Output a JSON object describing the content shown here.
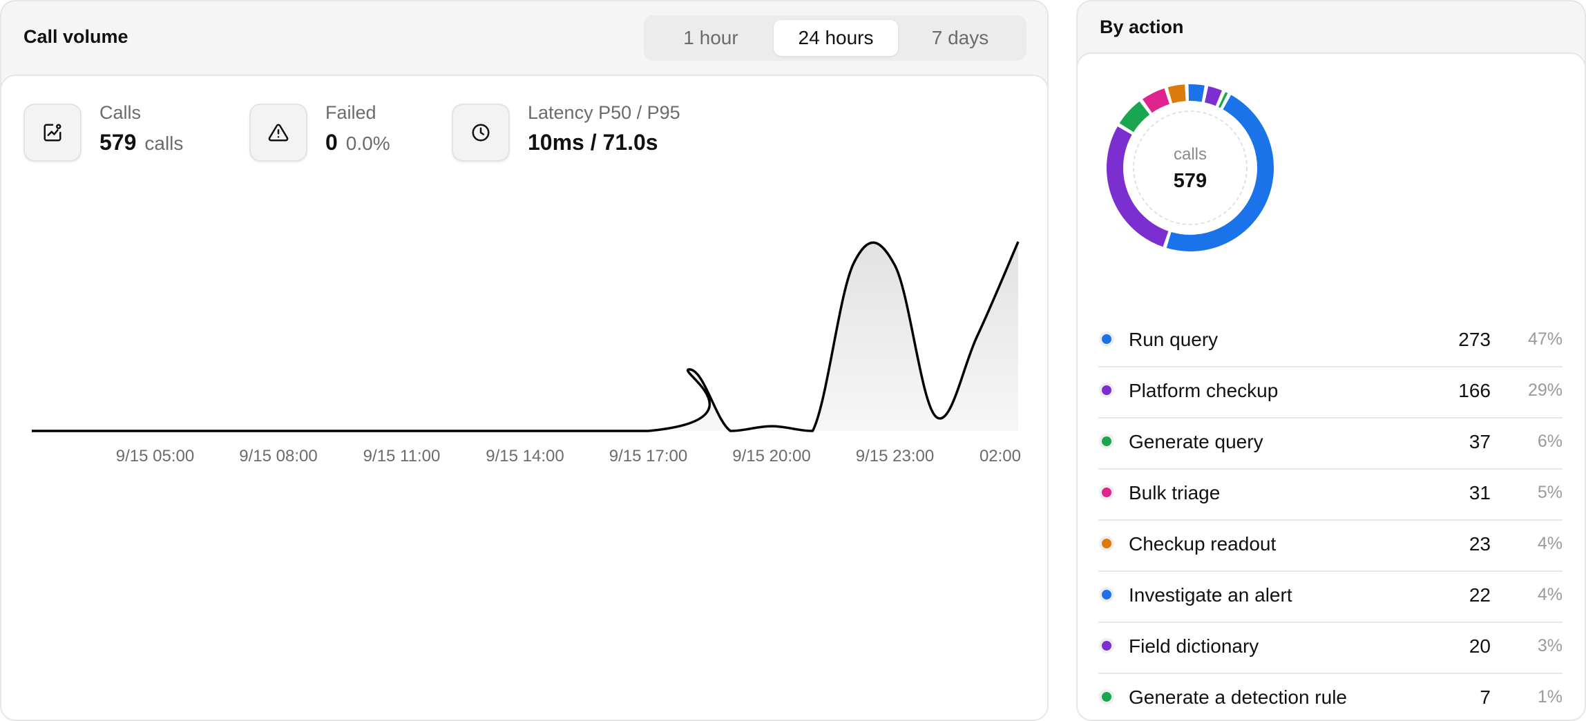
{
  "call_volume": {
    "title": "Call volume",
    "range_options": [
      "1 hour",
      "24 hours",
      "7 days"
    ],
    "selected_range": "24 hours",
    "stats": {
      "calls": {
        "label": "Calls",
        "value": "579",
        "unit": "calls",
        "icon": "chart-trend-icon"
      },
      "failed": {
        "label": "Failed",
        "value": "0",
        "unit": "0.0%",
        "icon": "warning-triangle-icon"
      },
      "latency": {
        "label": "Latency P50 / P95",
        "value": "10ms / 71.0s",
        "icon": "clock-icon"
      }
    }
  },
  "chart_data": {
    "type": "area",
    "title": "",
    "xlabel": "",
    "ylabel": "",
    "x_tick_labels": [
      "9/15 05:00",
      "9/15 08:00",
      "9/15 11:00",
      "9/15 14:00",
      "9/15 17:00",
      "9/15 20:00",
      "9/15 23:00",
      "02:00"
    ],
    "x_tick_hours": [
      5,
      8,
      11,
      14,
      17,
      20,
      23,
      26
    ],
    "x_range_hours": [
      2,
      26
    ],
    "y_axis_visible": false,
    "grid": false,
    "line_color": "#000000",
    "fill_gradient": [
      "#e2e2e2",
      "#f7f7f7"
    ],
    "series": [
      {
        "points": [
          [
            2,
            0
          ],
          [
            17,
            0
          ],
          [
            18,
            26
          ],
          [
            19,
            0
          ],
          [
            20,
            2
          ],
          [
            21,
            0
          ],
          [
            22,
            71
          ],
          [
            23,
            70
          ],
          [
            24,
            6
          ],
          [
            25,
            40
          ],
          [
            26,
            80
          ]
        ]
      }
    ]
  },
  "by_action": {
    "title": "By action",
    "total_label": "calls",
    "total": "579",
    "items": [
      {
        "label": "Run query",
        "count": 273,
        "pct": "47%",
        "color": "#1a73e8"
      },
      {
        "label": "Platform checkup",
        "count": 166,
        "pct": "29%",
        "color": "#7b2fd1"
      },
      {
        "label": "Generate query",
        "count": 37,
        "pct": "6%",
        "color": "#1aa650"
      },
      {
        "label": "Bulk triage",
        "count": 31,
        "pct": "5%",
        "color": "#e0248f"
      },
      {
        "label": "Checkup readout",
        "count": 23,
        "pct": "4%",
        "color": "#dc7a0b"
      },
      {
        "label": "Investigate an alert",
        "count": 22,
        "pct": "4%",
        "color": "#1a73e8"
      },
      {
        "label": "Field dictionary",
        "count": 20,
        "pct": "3%",
        "color": "#7b2fd1"
      },
      {
        "label": "Generate a detection rule",
        "count": 7,
        "pct": "1%",
        "color": "#1aa650"
      }
    ]
  }
}
